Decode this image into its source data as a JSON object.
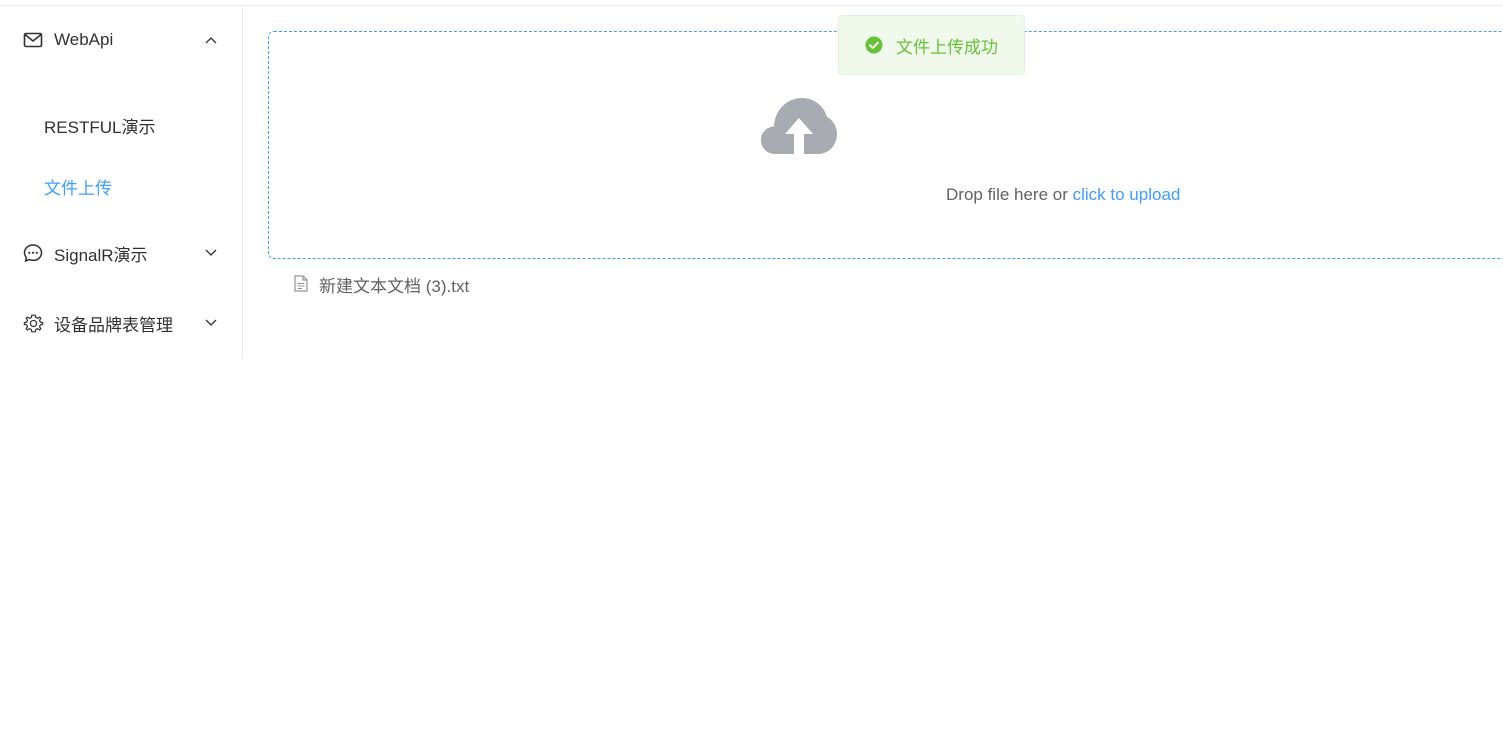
{
  "sidebar": {
    "menus": [
      {
        "label": "WebApi",
        "icon": "mail-icon",
        "expanded": true,
        "items": [
          {
            "label": "RESTFUL演示",
            "active": false
          },
          {
            "label": "文件上传",
            "active": true
          }
        ]
      },
      {
        "label": "SignalR演示",
        "icon": "chat-icon",
        "expanded": false
      },
      {
        "label": "设备品牌表管理",
        "icon": "gear-icon",
        "expanded": false
      }
    ]
  },
  "upload": {
    "icon": "cloud-upload-icon",
    "text_prefix": "Drop file here or",
    "text_link": "click to upload",
    "files": [
      {
        "name": "新建文本文档 (3).txt",
        "icon": "document-icon"
      }
    ]
  },
  "toast": {
    "type": "success",
    "icon": "success-check-icon",
    "message": "文件上传成功"
  },
  "colors": {
    "primary": "#409eff",
    "success": "#67c23a",
    "text": "#303133",
    "secondary_text": "#606266",
    "icon_gray": "#a8abb2"
  }
}
